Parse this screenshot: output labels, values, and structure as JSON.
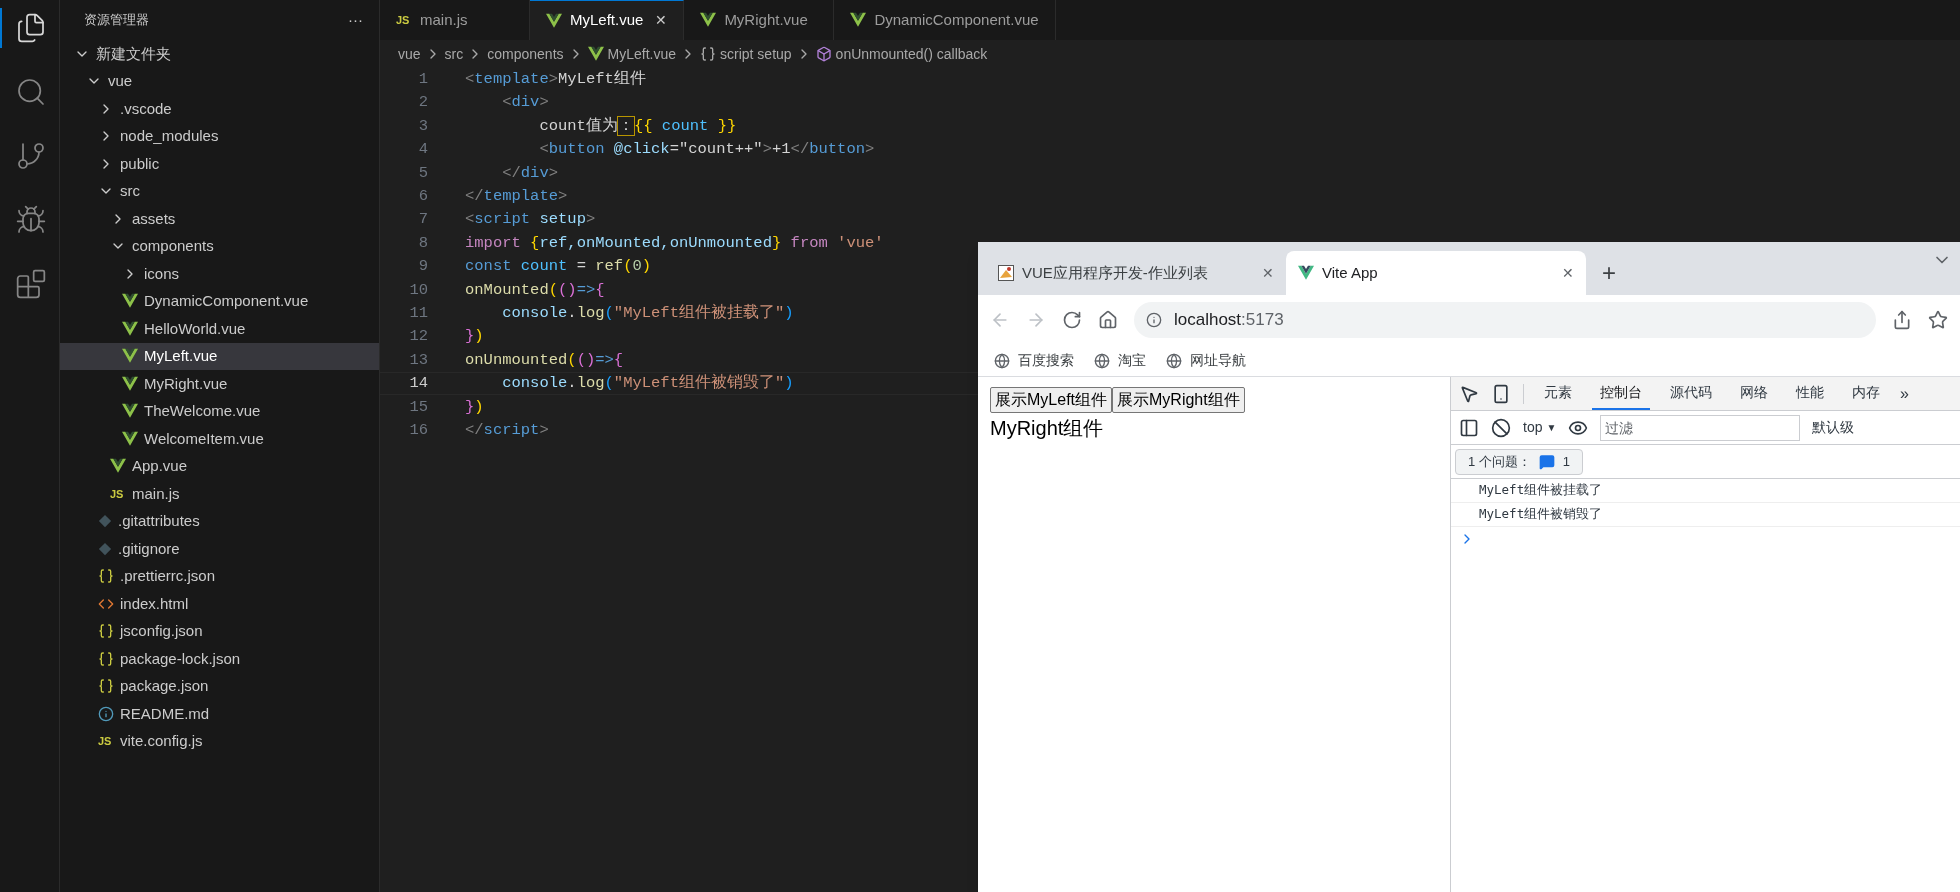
{
  "activity_bar": [
    {
      "kind": "files",
      "selected": true
    },
    {
      "kind": "search",
      "selected": false
    },
    {
      "kind": "git",
      "selected": false
    },
    {
      "kind": "debug",
      "selected": false
    },
    {
      "kind": "extensions",
      "selected": false
    }
  ],
  "explorer": {
    "title": "资源管理器",
    "more": "···",
    "tree": [
      {
        "label": "新建文件夹",
        "kind": "folder",
        "expanded": true,
        "selected": false,
        "children": [
          {
            "label": "vue",
            "kind": "folder",
            "expanded": true,
            "selected": false,
            "children": [
              {
                "label": ".vscode",
                "kind": "folder",
                "expanded": false,
                "selected": false
              },
              {
                "label": "node_modules",
                "kind": "folder",
                "expanded": false,
                "selected": false
              },
              {
                "label": "public",
                "kind": "folder",
                "expanded": false,
                "selected": false
              },
              {
                "label": "src",
                "kind": "folder",
                "expanded": true,
                "selected": false,
                "children": [
                  {
                    "label": "assets",
                    "kind": "folder",
                    "expanded": false,
                    "selected": false
                  },
                  {
                    "label": "components",
                    "kind": "folder",
                    "expanded": true,
                    "selected": false,
                    "children": [
                      {
                        "label": "icons",
                        "kind": "folder",
                        "expanded": false,
                        "selected": false
                      },
                      {
                        "label": "DynamicComponent.vue",
                        "kind": "vue",
                        "selected": false
                      },
                      {
                        "label": "HelloWorld.vue",
                        "kind": "vue",
                        "selected": false
                      },
                      {
                        "label": "MyLeft.vue",
                        "kind": "vue",
                        "selected": true
                      },
                      {
                        "label": "MyRight.vue",
                        "kind": "vue",
                        "selected": false
                      },
                      {
                        "label": "TheWelcome.vue",
                        "kind": "vue",
                        "selected": false
                      },
                      {
                        "label": "WelcomeItem.vue",
                        "kind": "vue",
                        "selected": false
                      }
                    ]
                  },
                  {
                    "label": "App.vue",
                    "kind": "vue",
                    "selected": false
                  },
                  {
                    "label": "main.js",
                    "kind": "js",
                    "icon_text": "JS",
                    "selected": false
                  }
                ]
              },
              {
                "label": ".gitattributes",
                "kind": "git",
                "selected": false
              },
              {
                "label": ".gitignore",
                "kind": "git",
                "selected": false
              },
              {
                "label": ".prettierrc.json",
                "kind": "json",
                "selected": false
              },
              {
                "label": "index.html",
                "kind": "html",
                "selected": false
              },
              {
                "label": "jsconfig.json",
                "kind": "json",
                "selected": false
              },
              {
                "label": "package-lock.json",
                "kind": "json",
                "selected": false
              },
              {
                "label": "package.json",
                "kind": "json",
                "selected": false
              },
              {
                "label": "README.md",
                "kind": "info",
                "selected": false
              },
              {
                "label": "vite.config.js",
                "kind": "js",
                "icon_text": "JS",
                "selected": false
              }
            ]
          }
        ]
      }
    ]
  },
  "editor_tabs": [
    {
      "label": "main.js",
      "kind": "js",
      "icon_text": "JS",
      "selected": false
    },
    {
      "label": "MyLeft.vue",
      "kind": "vue",
      "selected": true,
      "close": "✕"
    },
    {
      "label": "MyRight.vue",
      "kind": "vue",
      "selected": false
    },
    {
      "label": "DynamicComponent.vue",
      "kind": "vue",
      "selected": false
    }
  ],
  "breadcrumb": [
    {
      "label": "vue",
      "kind": "plain"
    },
    {
      "label": "src",
      "kind": "plain"
    },
    {
      "label": "components",
      "kind": "plain"
    },
    {
      "label": "MyLeft.vue",
      "kind": "vue"
    },
    {
      "label": "script setup",
      "kind": "braces"
    },
    {
      "label": "onUnmounted() callback",
      "kind": "cube"
    }
  ],
  "code": [
    {
      "number": "1",
      "current": false,
      "tokens": [
        {
          "text": "<",
          "kind": "punct"
        },
        {
          "text": "template",
          "kind": "tag"
        },
        {
          "text": ">",
          "kind": "punct"
        },
        {
          "text": "MyLeft组件",
          "kind": "plain"
        }
      ]
    },
    {
      "number": "2",
      "current": false,
      "tokens": [
        {
          "text": "    <",
          "kind": "punct"
        },
        {
          "text": "div",
          "kind": "tag"
        },
        {
          "text": ">",
          "kind": "punct"
        }
      ]
    },
    {
      "number": "3",
      "current": false,
      "tokens": [
        {
          "text": "        count值为",
          "kind": "plain"
        },
        {
          "text": "：",
          "kind": "match"
        },
        {
          "text": "{{",
          "kind": "brace"
        },
        {
          "text": " count ",
          "kind": "var"
        },
        {
          "text": "}}",
          "kind": "brace"
        }
      ]
    },
    {
      "number": "4",
      "current": false,
      "tokens": [
        {
          "text": "        <",
          "kind": "punct"
        },
        {
          "text": "button",
          "kind": "tag"
        },
        {
          "text": " @click",
          "kind": "attr"
        },
        {
          "text": "=\"count++\"",
          "kind": "plain"
        },
        {
          "text": ">",
          "kind": "punct"
        },
        {
          "text": "+1",
          "kind": "plain"
        },
        {
          "text": "</",
          "kind": "punct"
        },
        {
          "text": "button",
          "kind": "tag"
        },
        {
          "text": ">",
          "kind": "punct"
        }
      ]
    },
    {
      "number": "5",
      "current": false,
      "tokens": [
        {
          "text": "    </",
          "kind": "punct"
        },
        {
          "text": "div",
          "kind": "tag"
        },
        {
          "text": ">",
          "kind": "punct"
        }
      ]
    },
    {
      "number": "6",
      "current": false,
      "tokens": [
        {
          "text": "</",
          "kind": "punct"
        },
        {
          "text": "template",
          "kind": "tag"
        },
        {
          "text": ">",
          "kind": "punct"
        }
      ]
    },
    {
      "number": "7",
      "current": false,
      "tokens": [
        {
          "text": "<",
          "kind": "punct"
        },
        {
          "text": "script",
          "kind": "tag"
        },
        {
          "text": " setup",
          "kind": "attr"
        },
        {
          "text": ">",
          "kind": "punct"
        }
      ]
    },
    {
      "number": "8",
      "current": false,
      "tokens": [
        {
          "text": "import",
          "kind": "kw"
        },
        {
          "text": " {",
          "kind": "brace"
        },
        {
          "text": "ref,onMounted,onUnmounted",
          "kind": "attr"
        },
        {
          "text": "}",
          "kind": "brace"
        },
        {
          "text": " from ",
          "kind": "kw"
        },
        {
          "text": "'vue'",
          "kind": "str"
        }
      ]
    },
    {
      "number": "9",
      "current": false,
      "tokens": [
        {
          "text": "const",
          "kind": "decl"
        },
        {
          "text": " count",
          "kind": "var"
        },
        {
          "text": " = ",
          "kind": "plain"
        },
        {
          "text": "ref",
          "kind": "fn"
        },
        {
          "text": "(",
          "kind": "brace"
        },
        {
          "text": "0",
          "kind": "num"
        },
        {
          "text": ")",
          "kind": "brace"
        }
      ]
    },
    {
      "number": "10",
      "current": false,
      "tokens": [
        {
          "text": "onMounted",
          "kind": "fn"
        },
        {
          "text": "(",
          "kind": "brace"
        },
        {
          "text": "()",
          "kind": "paren2"
        },
        {
          "text": "=>",
          "kind": "decl"
        },
        {
          "text": "{",
          "kind": "paren2"
        }
      ]
    },
    {
      "number": "11",
      "current": false,
      "tokens": [
        {
          "text": "    console",
          "kind": "attr"
        },
        {
          "text": ".",
          "kind": "plain"
        },
        {
          "text": "log",
          "kind": "fn"
        },
        {
          "text": "(",
          "kind": "paren3"
        },
        {
          "text": "\"MyLeft组件被挂载了\"",
          "kind": "str"
        },
        {
          "text": ")",
          "kind": "paren3"
        }
      ]
    },
    {
      "number": "12",
      "current": false,
      "tokens": [
        {
          "text": "}",
          "kind": "paren2"
        },
        {
          "text": ")",
          "kind": "brace"
        }
      ]
    },
    {
      "number": "13",
      "current": false,
      "tokens": [
        {
          "text": "onUnmounted",
          "kind": "fn"
        },
        {
          "text": "(",
          "kind": "brace"
        },
        {
          "text": "()",
          "kind": "paren2"
        },
        {
          "text": "=>",
          "kind": "decl"
        },
        {
          "text": "{",
          "kind": "paren2"
        }
      ]
    },
    {
      "number": "14",
      "current": true,
      "tokens": [
        {
          "text": "    console",
          "kind": "attr"
        },
        {
          "text": ".",
          "kind": "plain"
        },
        {
          "text": "log",
          "kind": "fn"
        },
        {
          "text": "(",
          "kind": "paren3"
        },
        {
          "text": "\"MyLeft组件被销毁了\"",
          "kind": "str"
        },
        {
          "text": ")",
          "kind": "paren3"
        }
      ]
    },
    {
      "number": "15",
      "current": false,
      "tokens": [
        {
          "text": "}",
          "kind": "paren2"
        },
        {
          "text": ")",
          "kind": "brace"
        }
      ]
    },
    {
      "number": "16",
      "current": false,
      "tokens": [
        {
          "text": "</",
          "kind": "punct"
        },
        {
          "text": "script",
          "kind": "tag"
        },
        {
          "text": ">",
          "kind": "punct"
        }
      ]
    }
  ],
  "browser": {
    "tabs": [
      {
        "label": "VUE应用程序开发-作业列表",
        "kind": "picture",
        "selected": false,
        "close": "✕"
      },
      {
        "label": "Vite App",
        "kind": "vue",
        "selected": true,
        "close": "✕"
      }
    ],
    "new_tab": "+",
    "address": {
      "host": "localhost",
      "port": ":5173"
    },
    "bookmarks": [
      {
        "label": "百度搜索"
      },
      {
        "label": "淘宝"
      },
      {
        "label": "网址导航"
      }
    ],
    "page": {
      "buttons": [
        "展示MyLeft组件",
        "展示MyRight组件"
      ],
      "text": "MyRight组件"
    },
    "devtools": {
      "tabs": [
        {
          "label": "元素",
          "selected": false
        },
        {
          "label": "控制台",
          "selected": true
        },
        {
          "label": "源代码",
          "selected": false
        },
        {
          "label": "网络",
          "selected": false
        },
        {
          "label": "性能",
          "selected": false
        },
        {
          "label": "内存",
          "selected": false
        }
      ],
      "more": "»",
      "context": "top",
      "context_caret": "▼",
      "filter": {
        "placeholder": "过滤"
      },
      "level": "默认级",
      "issues": {
        "label": "1 个问题：",
        "count": "1"
      },
      "messages": [
        "MyLeft组件被挂载了",
        "MyLeft组件被销毁了"
      ]
    }
  }
}
